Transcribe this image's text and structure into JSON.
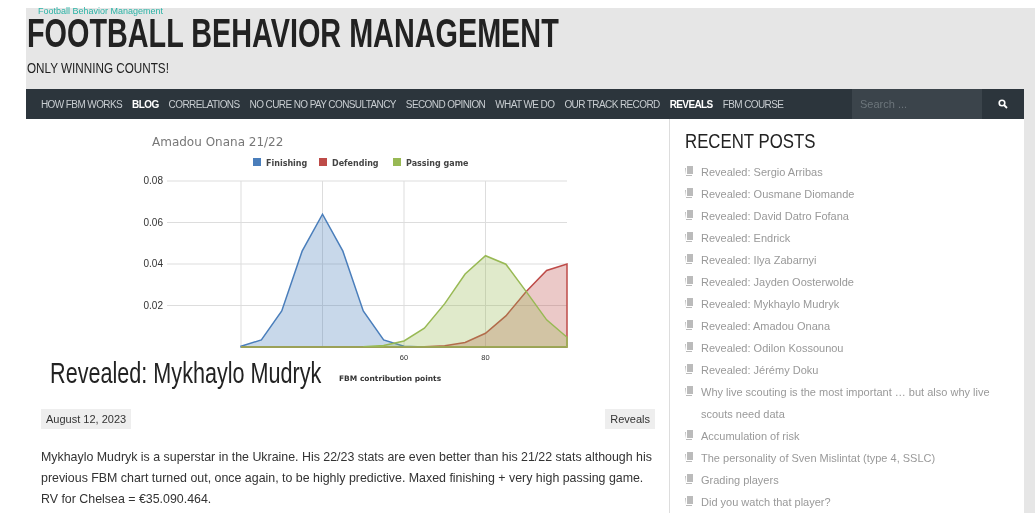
{
  "site": {
    "top_link": "Football Behavior Management",
    "title": "FOOTBALL BEHAVIOR MANAGEMENT",
    "tagline": "ONLY WINNING COUNTS!"
  },
  "nav": {
    "items": [
      {
        "label": "HOW FBM WORKS",
        "selected": false
      },
      {
        "label": "BLOG",
        "selected": true
      },
      {
        "label": "CORRELATIONS",
        "selected": false
      },
      {
        "label": "NO CURE NO PAY CONSULTANCY",
        "selected": false
      },
      {
        "label": "SECOND OPINION",
        "selected": false
      },
      {
        "label": "WHAT WE DO",
        "selected": false
      },
      {
        "label": "OUR TRACK RECORD",
        "selected": false
      },
      {
        "label": "REVEALS",
        "selected": true
      },
      {
        "label": "FBM COURSE",
        "selected": false
      }
    ],
    "search": {
      "placeholder": "Search ..."
    }
  },
  "post": {
    "chart_data": {
      "type": "area",
      "title": "Amadou Onana 21/22",
      "xlabel": "FBM contribution points",
      "x": [
        20,
        25,
        30,
        35,
        40,
        45,
        50,
        55,
        60,
        65,
        70,
        75,
        80,
        85,
        90,
        95,
        100
      ],
      "grid": true,
      "legend": "top",
      "xlim": [
        20,
        100
      ],
      "ylim": [
        0,
        0.08
      ],
      "xticks": [
        60,
        80
      ],
      "yticks": [
        {
          "value": 0.02,
          "label": "0.02"
        },
        {
          "value": 0.04,
          "label": "0.04"
        },
        {
          "value": 0.06,
          "label": "0.06"
        },
        {
          "value": 0.08,
          "label": "0.08"
        }
      ],
      "series": [
        {
          "name": "Finishing",
          "color": "#4a7ebb",
          "values": [
            0.0004,
            0.0034,
            0.0174,
            0.0462,
            0.064,
            0.0462,
            0.0174,
            0.0034,
            0.0004,
            0,
            0,
            0,
            0,
            0,
            0,
            0,
            0
          ]
        },
        {
          "name": "Defending",
          "color": "#be4b48",
          "values": [
            0,
            0,
            0,
            0,
            0,
            0,
            0,
            0,
            0,
            0.0001,
            0.0006,
            0.0022,
            0.0066,
            0.015,
            0.0267,
            0.0369,
            0.04
          ]
        },
        {
          "name": "Passing game",
          "color": "#98b954",
          "values": [
            0,
            0,
            0,
            0,
            0,
            0,
            0.0001,
            0.0007,
            0.0029,
            0.0091,
            0.0209,
            0.0352,
            0.044,
            0.0399,
            0.0267,
            0.0131,
            0.0047
          ]
        }
      ]
    },
    "title": "Revealed: Mykhaylo Mudryk",
    "date": "August 12, 2023",
    "category": "Reveals",
    "body": "Mykhaylo Mudryk is a superstar in the Ukraine. His 22/23 stats are even better than his 21/22 stats although his previous FBM chart turned out, once again, to be highly predictive. Maxed finishing + very high passing game. RV for Chelsea = €35.090.464."
  },
  "sidebar": {
    "heading": "RECENT POSTS",
    "posts": [
      "Revealed: Sergio Arribas",
      "Revealed: Ousmane Diomande",
      "Revealed: David Datro Fofana",
      "Revealed: Endrick",
      "Revealed: Ilya Zabarnyi",
      "Revealed: Jayden Oosterwolde",
      "Revealed: Mykhaylo Mudryk",
      "Revealed: Amadou Onana",
      "Revealed: Odilon Kossounou",
      "Revealed: Jérémy Doku",
      "Why live scouting is the most important … but also why live scouts need data",
      "Accumulation of risk",
      "The personality of Sven Mislintat (type 4, SSLC)",
      "Grading players",
      "Did you watch that player?"
    ]
  }
}
